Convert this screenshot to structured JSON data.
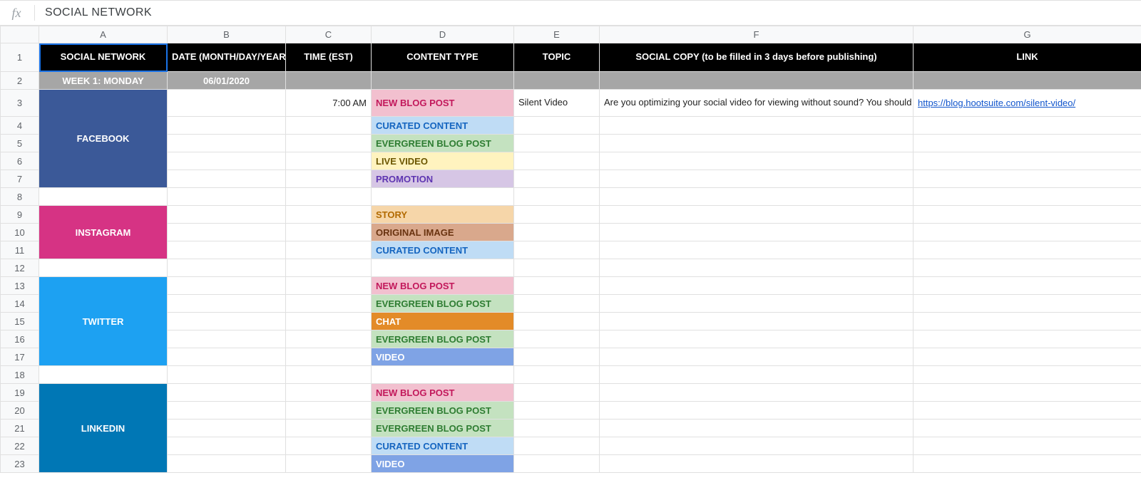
{
  "formula_bar": {
    "fx": "fx",
    "value": "SOCIAL NETWORK"
  },
  "columns": [
    "A",
    "B",
    "C",
    "D",
    "E",
    "F",
    "G"
  ],
  "row_numbers": [
    1,
    2,
    3,
    4,
    5,
    6,
    7,
    8,
    9,
    10,
    11,
    12,
    13,
    14,
    15,
    16,
    17,
    18,
    19,
    20,
    21,
    22,
    23
  ],
  "headers": {
    "A": "SOCIAL NETWORK",
    "B": "DATE (MONTH/DAY/YEAR)",
    "C": "TIME (EST)",
    "D": "CONTENT TYPE",
    "E": "TOPIC",
    "F": "SOCIAL COPY (to be filled in 3 days before publishing)",
    "G": "LINK"
  },
  "row2": {
    "A": "WEEK 1: MONDAY",
    "B": "06/01/2020"
  },
  "row3": {
    "C": "7:00 AM",
    "D": "NEW BLOG POST",
    "E": "Silent Video",
    "F": "Are you optimizing your social video for viewing without sound? You should be",
    "G": "https://blog.hootsuite.com/silent-video/"
  },
  "networks": {
    "facebook": "FACEBOOK",
    "instagram": "INSTAGRAM",
    "twitter": "TWITTER",
    "linkedin": "LINKEDIN"
  },
  "content_types": {
    "r3": "NEW BLOG POST",
    "r4": "CURATED CONTENT",
    "r5": "EVERGREEN BLOG POST",
    "r6": "LIVE VIDEO",
    "r7": "PROMOTION",
    "r9": "STORY",
    "r10": "ORIGINAL IMAGE",
    "r11": "CURATED CONTENT",
    "r13": "NEW BLOG POST",
    "r14": "EVERGREEN BLOG POST",
    "r15": "CHAT",
    "r16": "EVERGREEN BLOG POST",
    "r17": "VIDEO",
    "r19": "NEW BLOG POST",
    "r20": "EVERGREEN BLOG POST",
    "r21": "EVERGREEN BLOG POST",
    "r22": "CURATED CONTENT",
    "r23": "VIDEO"
  }
}
